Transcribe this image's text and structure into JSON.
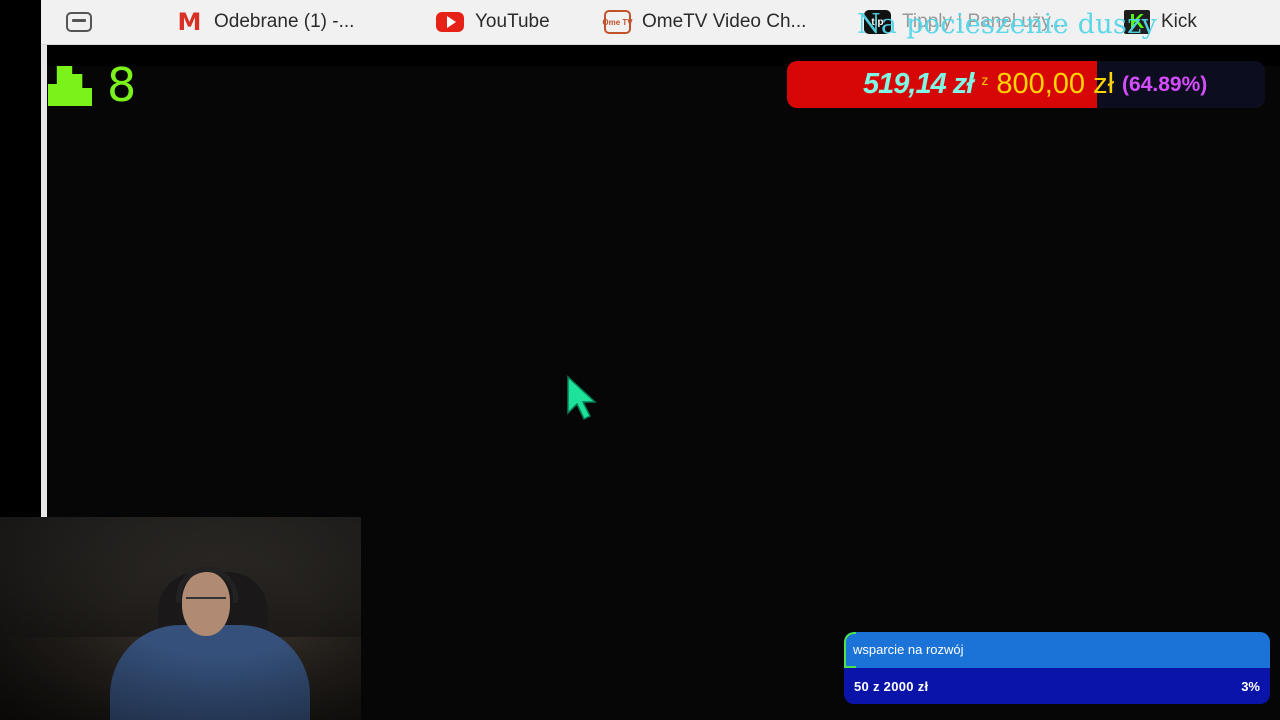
{
  "bookmarks": [
    {
      "label": "",
      "icon": "tab-icon"
    },
    {
      "label": "Odebrane (1) -...",
      "icon": "gmail-icon",
      "glyph": "M"
    },
    {
      "label": "YouTube",
      "icon": "youtube-icon",
      "glyph": ""
    },
    {
      "label": "OmeTV Video Ch...",
      "icon": "ometv-icon",
      "glyph": "Ome TV"
    },
    {
      "label": "Tipply | Panel uży...",
      "icon": "tipply-icon",
      "glyph": "tip"
    },
    {
      "label": "Kick",
      "icon": "kick-icon",
      "glyph": "K"
    }
  ],
  "overlay": {
    "title": "Na pocieszenie duszy"
  },
  "viewers": {
    "count": "8",
    "icon": "viewers-icon",
    "color": "#7cf21b"
  },
  "goal": {
    "current": "519,14 zł",
    "separator": "z",
    "target": "800,00 zł",
    "percent_label": "(64.89%)",
    "progress": 0.6489,
    "fill_color": "#d80707",
    "current_color": "#7ff7e4",
    "target_color": "#ffd400",
    "percent_color": "#d64cff"
  },
  "support": {
    "title": "wsparcie na rozwój",
    "amount": "50 z 2000 zł",
    "percent": "3%",
    "progress": 0.025,
    "top_color": "#1b73d8",
    "bottom_color": "#0a14a8"
  },
  "cursor": {
    "icon": "mouse-cursor-icon",
    "color": "#1de39a"
  }
}
